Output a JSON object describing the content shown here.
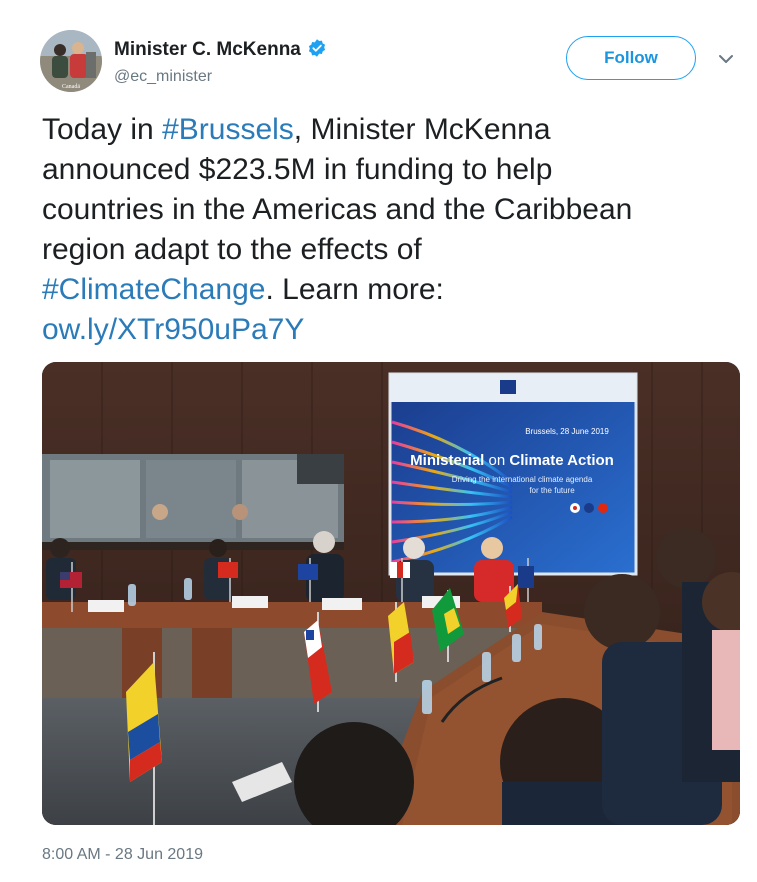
{
  "author": {
    "name": "Minister C. McKenna",
    "handle": "@ec_minister",
    "avatar_caption": "Canadā"
  },
  "follow_button": {
    "label": "Follow"
  },
  "tweet": {
    "lines": [
      [
        {
          "text": "Today in ",
          "type": "text"
        },
        {
          "text": "#Brussels",
          "type": "hashtag"
        },
        {
          "text": ", Minister McKenna",
          "type": "text"
        }
      ],
      [
        {
          "text": "announced $223.5M in funding to help",
          "type": "text"
        }
      ],
      [
        {
          "text": "countries in the Americas and the Caribbean",
          "type": "text"
        }
      ],
      [
        {
          "text": "region adapt to the effects of",
          "type": "text"
        }
      ],
      [
        {
          "text": "#ClimateChange",
          "type": "hashtag"
        },
        {
          "text": ". Learn more:",
          "type": "text"
        }
      ],
      [
        {
          "text": "ow.ly/XTr950uPa7Y",
          "type": "link"
        }
      ]
    ]
  },
  "photo": {
    "banner": {
      "date": "Brussels, 28 June 2019",
      "title_a": "Ministerial",
      "title_b": " on ",
      "title_c": "Climate Action",
      "subtitle_1": "Driving the international climate agenda",
      "subtitle_2": "for the future"
    }
  },
  "timestamp": "8:00 AM - 28 Jun 2019",
  "colors": {
    "link": "#2b7bb9",
    "follow_border": "#1da1f2",
    "follow_text": "#1b95e0",
    "verified": "#1da1f2",
    "secondary_text": "#697882"
  }
}
